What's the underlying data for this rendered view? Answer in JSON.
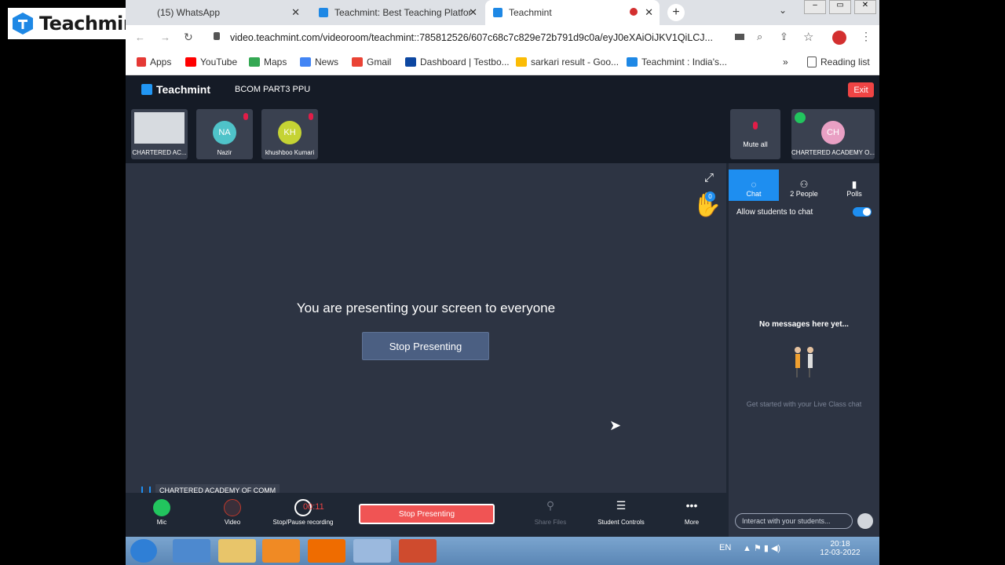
{
  "watermark": {
    "text": "Teachmint"
  },
  "browser": {
    "tabs": [
      {
        "title": "(15) WhatsApp"
      },
      {
        "title": "Teachmint: Best Teaching Platfor"
      },
      {
        "title": "Teachmint"
      }
    ],
    "url": "video.teachmint.com/videoroom/teachmint::785812526/607c68c7c829e72b791d9c0a/eyJ0eXAiOiJKV1QiLCJ...",
    "bookmarks": [
      "Apps",
      "YouTube",
      "Maps",
      "News",
      "Gmail",
      "Dashboard | Testbo...",
      "sarkari result - Goo...",
      "Teachmint : India's..."
    ],
    "reading_list": "Reading list"
  },
  "app": {
    "brand": "Teachmint",
    "class_name": "BCOM PART3 PPU",
    "exit_label": "Exit",
    "participants": [
      {
        "initials": "",
        "name": "CHARTERED AC...",
        "color": "#e5e7eb"
      },
      {
        "initials": "NA",
        "name": "Nazir",
        "color": "#4fc3c9"
      },
      {
        "initials": "KH",
        "name": "khushboo Kumari",
        "color": "#c5d334"
      }
    ],
    "mute_all_label": "Mute all",
    "host": {
      "initials": "CH",
      "name": "CHARTERED ACADEMY O...",
      "color": "#e9a0c4"
    },
    "hand_raise_count": "0",
    "stage_message": "You are presenting your screen to everyone",
    "stop_presenting_label": "Stop Presenting",
    "speaker_label": "CHARTERED ACADEMY OF COMM",
    "controls": {
      "mic": "Mic",
      "video": "Video",
      "recording": "Stop/Pause recording",
      "recording_time": "00:11",
      "stop_presenting": "Stop Presenting",
      "share_files": "Share Files",
      "student_controls": "Student Controls",
      "more": "More"
    },
    "chat": {
      "tab_chat": "Chat",
      "tab_people": "2 People",
      "tab_polls": "Polls",
      "allow_label": "Allow students to chat",
      "allow_enabled": true,
      "empty_title": "No messages here yet...",
      "empty_subtitle": "Get started with your Live Class chat",
      "input_placeholder": "Interact with your students..."
    },
    "accent": "#1e8ef0",
    "danger": "#ef4444"
  },
  "taskbar": {
    "lang": "EN",
    "time": "20:18",
    "date": "12-03-2022"
  }
}
